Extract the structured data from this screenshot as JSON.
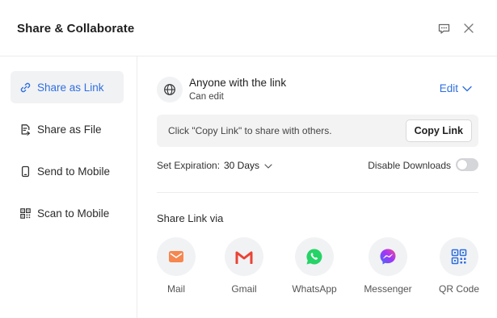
{
  "dialog": {
    "title": "Share & Collaborate",
    "header_icons": [
      "feedback-icon",
      "close-icon"
    ]
  },
  "sidebar": {
    "items": [
      {
        "label": "Share as Link",
        "icon": "link-icon",
        "active": true
      },
      {
        "label": "Share as File",
        "icon": "file-share-icon",
        "active": false
      },
      {
        "label": "Send to Mobile",
        "icon": "mobile-icon",
        "active": false
      },
      {
        "label": "Scan to Mobile",
        "icon": "qr-scan-icon",
        "active": false
      }
    ]
  },
  "access": {
    "title": "Anyone with the link",
    "permission": "Can edit",
    "edit_label": "Edit"
  },
  "link": {
    "hint": "Click \"Copy Link\" to share with others.",
    "copy_label": "Copy Link"
  },
  "expiration": {
    "label": "Set Expiration:",
    "value": "30 Days"
  },
  "downloads": {
    "label": "Disable Downloads",
    "enabled": false
  },
  "share_via": {
    "heading": "Share Link via",
    "targets": [
      {
        "label": "Mail",
        "icon": "mail-icon"
      },
      {
        "label": "Gmail",
        "icon": "gmail-icon"
      },
      {
        "label": "WhatsApp",
        "icon": "whatsapp-icon"
      },
      {
        "label": "Messenger",
        "icon": "messenger-icon"
      },
      {
        "label": "QR Code",
        "icon": "qr-code-icon"
      }
    ]
  },
  "colors": {
    "accent": "#2f6fe0",
    "active_bg": "#f1f2f4",
    "mail": "#f5874f",
    "gmail": "#ea4335",
    "whatsapp": "#25d366",
    "messenger": "#a334fa",
    "qr": "#2f6fe0"
  }
}
